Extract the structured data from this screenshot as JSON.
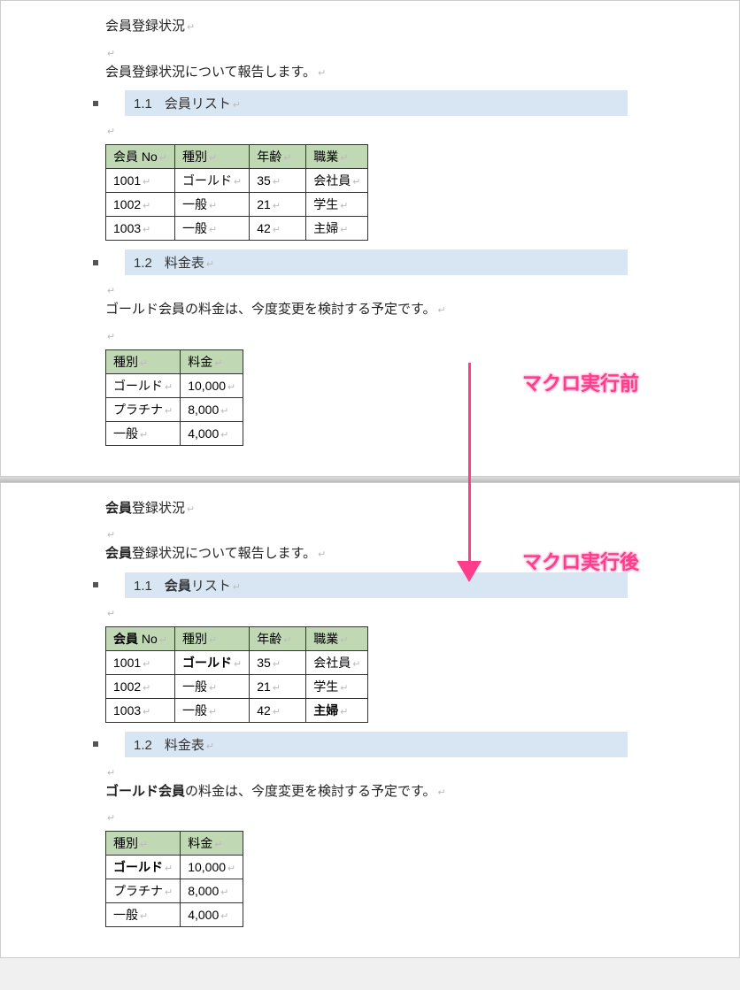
{
  "annotations": {
    "before": "マクロ実行前",
    "after": "マクロ実行後"
  },
  "before": {
    "title": "会員登録状況",
    "intro": "会員登録状況について報告します。",
    "section1": {
      "num": "1.1",
      "label": "会員リスト"
    },
    "table1": {
      "headers": [
        "会員 No",
        "種別",
        "年齢",
        "職業"
      ],
      "rows": [
        [
          "1001",
          "ゴールド",
          "35",
          "会社員"
        ],
        [
          "1002",
          "一般",
          "21",
          "学生"
        ],
        [
          "1003",
          "一般",
          "42",
          "主婦"
        ]
      ]
    },
    "section2": {
      "num": "1.2",
      "label": "料金表"
    },
    "note2": "ゴールド会員の料金は、今度変更を検討する予定です。",
    "table2": {
      "headers": [
        "種別",
        "料金"
      ],
      "rows": [
        [
          "ゴールド",
          "10,000"
        ],
        [
          "プラチナ",
          "8,000"
        ],
        [
          "一般",
          "4,000"
        ]
      ]
    }
  },
  "after": {
    "title_pre": "会員",
    "title_rest": "登録状況",
    "intro_pre": "会員",
    "intro_rest": "登録状況について報告します。",
    "section1": {
      "num": "1.1",
      "label_pre": "会員",
      "label_rest": "リスト"
    },
    "table1": {
      "headers": {
        "h0_pre": "会員",
        "h0_rest": " No",
        "h1": "種別",
        "h2": "年齢",
        "h3": "職業"
      },
      "rows": [
        {
          "c0": "1001",
          "c1_bold": "ゴールド",
          "c2": "35",
          "c3": "会社員"
        },
        {
          "c0": "1002",
          "c1": "一般",
          "c2": "21",
          "c3": "学生"
        },
        {
          "c0": "1003",
          "c1": "一般",
          "c2": "42",
          "c3_bold": "主婦"
        }
      ]
    },
    "section2": {
      "num": "1.2",
      "label": "料金表"
    },
    "note2_pre": "ゴールド会員",
    "note2_rest": "の料金は、今度変更を検討する予定です。",
    "table2": {
      "headers": [
        "種別",
        "料金"
      ],
      "rows": [
        {
          "c0_bold": "ゴールド",
          "c1": "10,000"
        },
        {
          "c0": "プラチナ",
          "c1": "8,000"
        },
        {
          "c0": "一般",
          "c1": "4,000"
        }
      ]
    }
  }
}
